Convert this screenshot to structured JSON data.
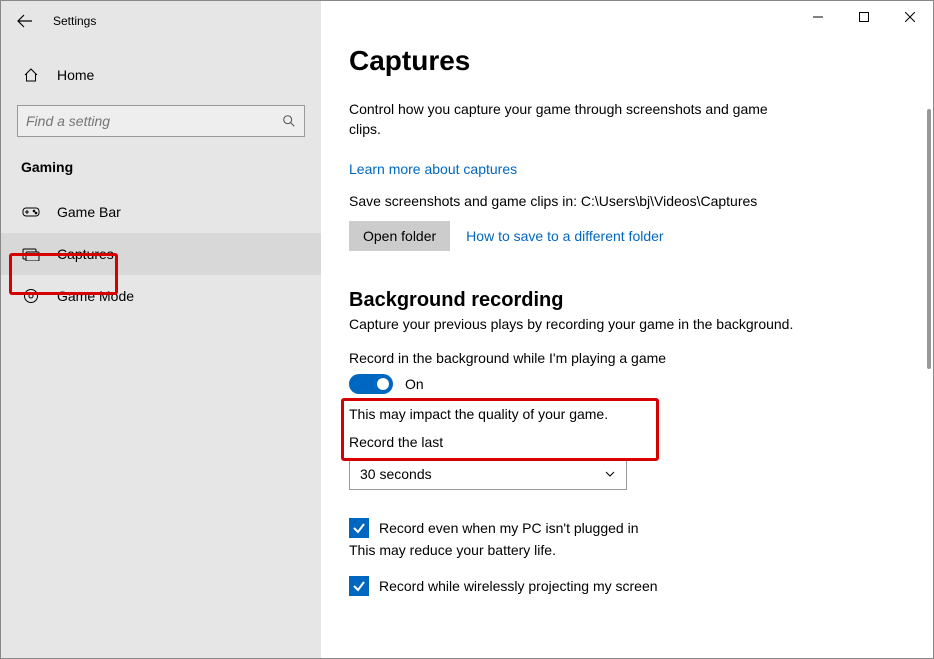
{
  "window": {
    "title": "Settings"
  },
  "sidebar": {
    "home": "Home",
    "search_placeholder": "Find a setting",
    "category": "Gaming",
    "items": [
      {
        "label": "Game Bar"
      },
      {
        "label": "Captures"
      },
      {
        "label": "Game Mode"
      }
    ]
  },
  "page": {
    "title": "Captures",
    "subtitle": "Control how you capture your game through screenshots and game clips.",
    "learn_link": "Learn more about captures",
    "save_line": "Save screenshots and game clips in: C:\\Users\\bj\\Videos\\Captures",
    "open_folder": "Open folder",
    "how_to_link": "How to save to a different folder",
    "bg_heading": "Background recording",
    "bg_desc": "Capture your previous plays by recording your game in the background.",
    "record_toggle_label": "Record in the background while I'm playing a game",
    "toggle_state": "On",
    "quality_note": "This may impact the quality of your game.",
    "record_last_label": "Record the last",
    "record_last_value": "30 seconds",
    "check1": "Record even when my PC isn't plugged in",
    "battery_note": "This may reduce your battery life.",
    "check2": "Record while wirelessly projecting my screen"
  }
}
